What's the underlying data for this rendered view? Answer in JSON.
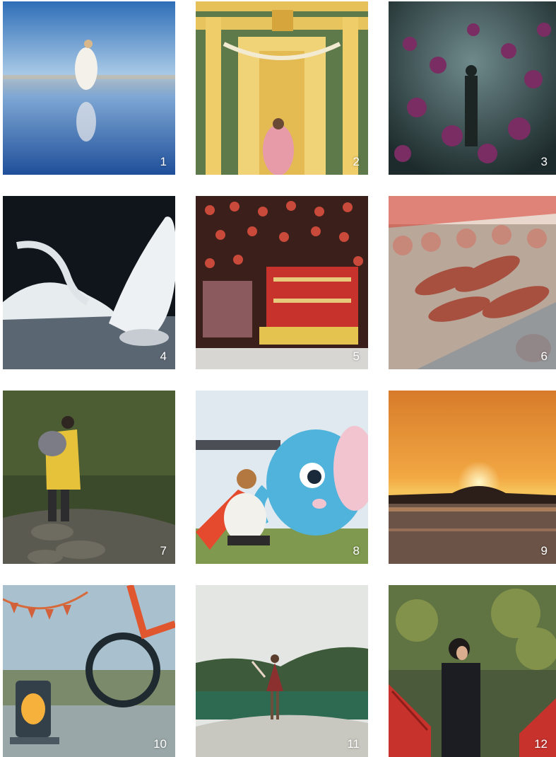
{
  "gallery": {
    "tiles": [
      {
        "number": "1",
        "subject": "woman-on-mirror-beach"
      },
      {
        "number": "2",
        "subject": "yellow-torii-shrine"
      },
      {
        "number": "3",
        "subject": "flower-field-silhouette"
      },
      {
        "number": "4",
        "subject": "swans-on-water"
      },
      {
        "number": "5",
        "subject": "hina-doll-display"
      },
      {
        "number": "6",
        "subject": "sweet-potato-market"
      },
      {
        "number": "7",
        "subject": "hiker-in-forest"
      },
      {
        "number": "8",
        "subject": "blue-elephant-slide"
      },
      {
        "number": "9",
        "subject": "sunset-over-mountain-lake"
      },
      {
        "number": "10",
        "subject": "lantern-and-bicycle"
      },
      {
        "number": "11",
        "subject": "woman-at-green-lake"
      },
      {
        "number": "12",
        "subject": "woman-on-red-bridge"
      }
    ]
  },
  "colors": {
    "background": "#ffffff",
    "number_text": "#ffffff"
  }
}
